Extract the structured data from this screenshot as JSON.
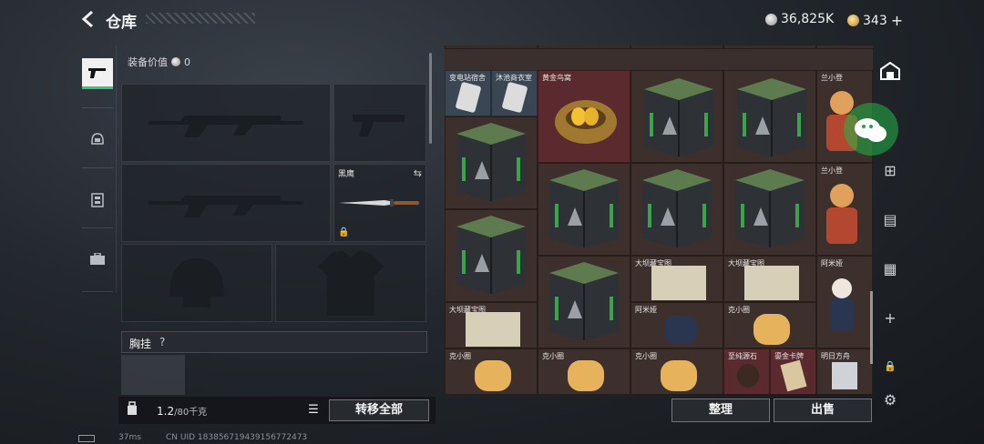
{
  "header": {
    "title": "仓库",
    "currency_silver": "36,825K",
    "currency_gold": "343"
  },
  "equipment": {
    "value_label": "装备价值",
    "value": "0",
    "knife_slot_name": "黑鹰",
    "chest_label": "胸挂",
    "chest_help": "?"
  },
  "footer_left": {
    "weight_value": "1.2",
    "weight_max": "/80千克",
    "transfer_all": "转移全部"
  },
  "inventory": {
    "row0": [
      "变电站宿舍",
      "沐池商衣室",
      "黄金鸟窝",
      "",
      "",
      "兰小登"
    ],
    "labels": {
      "r1c5": "兰小登",
      "map1": "大坝藏宝图",
      "map2": "大坝藏宝图",
      "amiya1": "阿米娅",
      "map3": "大坝藏宝图",
      "amiya2": "阿米娅",
      "kexiao1": "克小圈",
      "kexiao2": "克小圈",
      "kexiao3": "克小圈",
      "kexiao4": "克小圈",
      "kexiao5": "克小圈",
      "stone": "至纯源石",
      "card": "鎏金卡牌",
      "book": "明日方舟"
    }
  },
  "actions": {
    "sort": "整理",
    "sell": "出售"
  },
  "status": {
    "fps": "37ms",
    "uid": "CN UID 1838567194391567724​73"
  },
  "colors": {
    "accent_green": "#39c27a",
    "red_cell": "#5a2a2e",
    "blue_cell": "#3a4654"
  }
}
